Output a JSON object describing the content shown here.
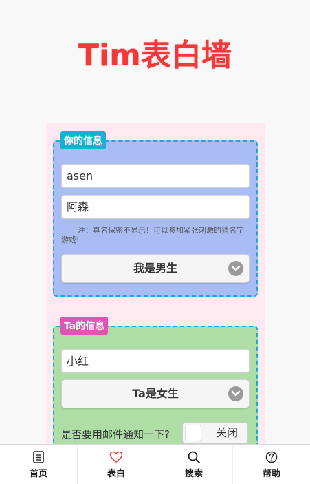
{
  "title": "Tim表白墙",
  "my_info": {
    "tag": "你的信息",
    "name_value": "asen",
    "realname_value": "阿森",
    "note": "注：真名保密不显示！可以参加紧张刺激的猜名字游戏!",
    "gender_select": "我是男生"
  },
  "ta_info": {
    "tag": "Ta的信息",
    "name_value": "小红",
    "gender_select": "Ta是女生",
    "mail_question": "是否要用邮件通知一下?",
    "mail_toggle": "关闭"
  },
  "tabs": [
    {
      "label": "首页",
      "icon": "document-icon"
    },
    {
      "label": "表白",
      "icon": "heart-icon",
      "active": true
    },
    {
      "label": "搜索",
      "icon": "search-icon"
    },
    {
      "label": "帮助",
      "icon": "help-icon"
    }
  ],
  "colors": {
    "title": "#f03a3a",
    "my_card": "#a9bcf3",
    "ta_card": "#afdda6",
    "my_tag": "#11b3d0",
    "ta_tag": "#e254b4",
    "active_tab_icon": "#e04040"
  }
}
